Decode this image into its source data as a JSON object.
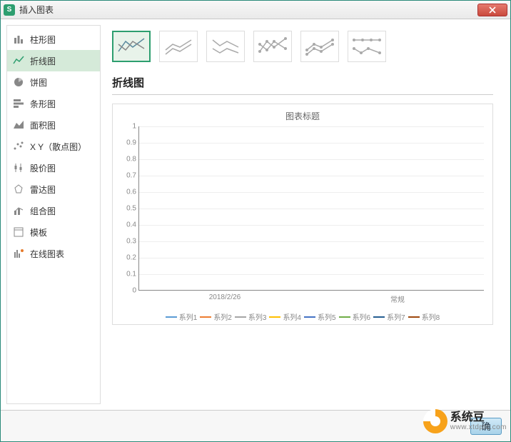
{
  "window": {
    "title": "插入图表",
    "app_icon_letter": "S"
  },
  "sidebar": {
    "items": [
      {
        "label": "柱形图",
        "icon": "bar-icon"
      },
      {
        "label": "折线图",
        "icon": "line-icon",
        "selected": true
      },
      {
        "label": "饼图",
        "icon": "pie-icon"
      },
      {
        "label": "条形图",
        "icon": "hbar-icon"
      },
      {
        "label": "面积图",
        "icon": "area-icon"
      },
      {
        "label": "X Y（散点图）",
        "icon": "scatter-icon"
      },
      {
        "label": "股价图",
        "icon": "stock-icon"
      },
      {
        "label": "雷达图",
        "icon": "radar-icon"
      },
      {
        "label": "组合图",
        "icon": "combo-icon"
      },
      {
        "label": "模板",
        "icon": "template-icon"
      },
      {
        "label": "在线图表",
        "icon": "online-icon"
      }
    ]
  },
  "main": {
    "section_title": "折线图",
    "subtypes": [
      "basic-line",
      "stacked-line",
      "percent-line",
      "line-markers",
      "stacked-markers",
      "percent-markers"
    ]
  },
  "chart_data": {
    "type": "line",
    "title": "图表标题",
    "ylim": [
      0,
      1
    ],
    "yticks": [
      0,
      0.1,
      0.2,
      0.3,
      0.4,
      0.5,
      0.6,
      0.7,
      0.8,
      0.9,
      1
    ],
    "categories": [
      "2018/2/26",
      "常规"
    ],
    "series": [
      {
        "name": "系列1",
        "color": "#5b9bd5",
        "values": [
          0,
          0
        ]
      },
      {
        "name": "系列2",
        "color": "#ed7d31",
        "values": [
          0,
          0
        ]
      },
      {
        "name": "系列3",
        "color": "#a5a5a5",
        "values": [
          0,
          0
        ]
      },
      {
        "name": "系列4",
        "color": "#ffc000",
        "values": [
          0,
          0
        ]
      },
      {
        "name": "系列5",
        "color": "#4472c4",
        "values": [
          0,
          0
        ]
      },
      {
        "name": "系列6",
        "color": "#70ad47",
        "values": [
          0,
          0
        ]
      },
      {
        "name": "系列7",
        "color": "#255e91",
        "values": [
          0,
          0
        ]
      },
      {
        "name": "系列8",
        "color": "#9e480e",
        "values": [
          0,
          0
        ]
      }
    ]
  },
  "buttons": {
    "ok": "确"
  },
  "watermark": {
    "name": "系统豆",
    "url": "www.xtdptc.com"
  }
}
